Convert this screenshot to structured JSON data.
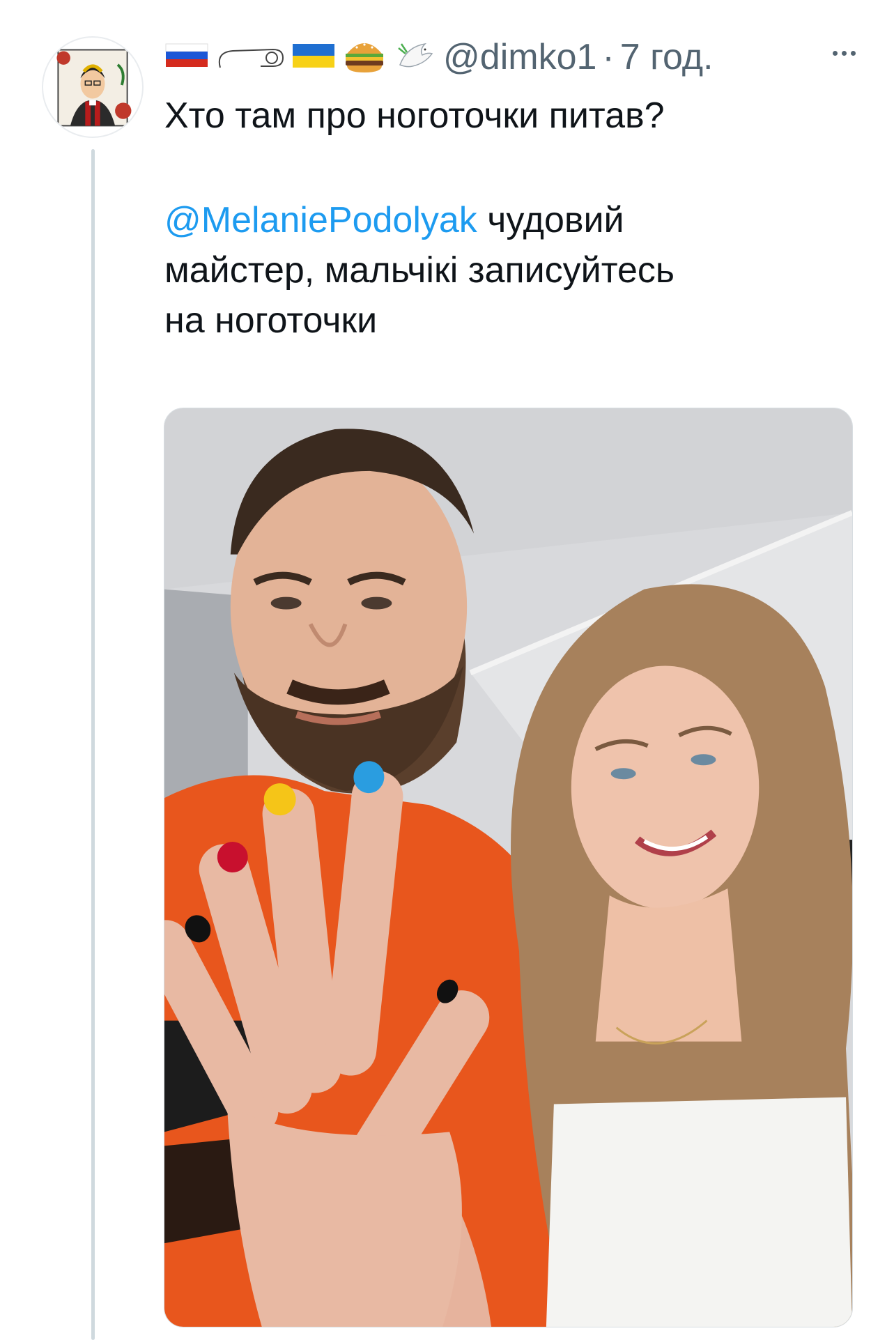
{
  "tweet": {
    "author": {
      "handle": "@dimko1",
      "avatar_icon": "priest-portrait-avatar"
    },
    "name_emojis": [
      "russia-flag-icon",
      "nail-polish-bottle-icon",
      "ukraine-flag-icon",
      "burger-icon",
      "dove-icon"
    ],
    "separator": "·",
    "time": "7 год.",
    "more_icon": "more-dots-icon",
    "text": "Хто там про ноготочки питав?",
    "quote_mention": "@MelaniePodolyak",
    "quote_text_line1": " чудовий",
    "quote_text_line2": "майстер, мальчікі записуйтесь",
    "quote_text_line3": "на ноготочки",
    "media": {
      "description_icon": "selfie-photo",
      "nail_colors": [
        "#000000",
        "#c8102e",
        "#f5c518",
        "#2a9de0"
      ]
    }
  },
  "colors": {
    "text": "#0f1419",
    "secondary": "#536471",
    "link": "#1d9bf0",
    "thread_line": "#cfd9de"
  }
}
